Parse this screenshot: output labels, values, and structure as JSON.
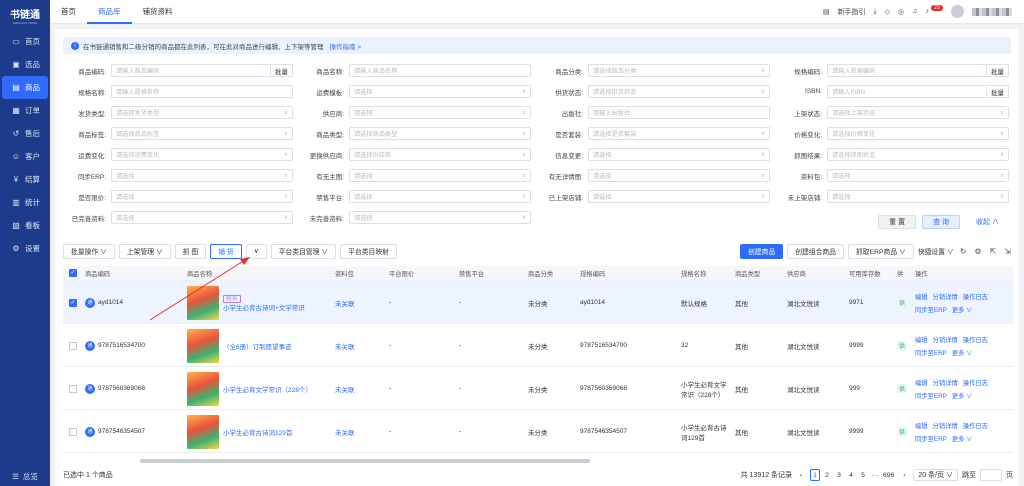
{
  "app": {
    "name": "书链通",
    "subtitle": "SHULIAN TONG"
  },
  "sidebar": {
    "items": [
      {
        "label": "首页",
        "icon": "desktop-icon"
      },
      {
        "label": "选品",
        "icon": "select-icon"
      },
      {
        "label": "商品",
        "icon": "product-icon"
      },
      {
        "label": "订单",
        "icon": "order-icon"
      },
      {
        "label": "售后",
        "icon": "aftersale-icon"
      },
      {
        "label": "客户",
        "icon": "customer-icon"
      },
      {
        "label": "结算",
        "icon": "settle-icon"
      },
      {
        "label": "统计",
        "icon": "stats-icon"
      },
      {
        "label": "看板",
        "icon": "board-icon"
      },
      {
        "label": "设置",
        "icon": "settings-icon"
      }
    ],
    "bottom": "总览"
  },
  "topbar": {
    "tabs": [
      "首页",
      "商品库",
      "铺货资料"
    ],
    "guide": "新手指引",
    "badge": "29"
  },
  "notice": {
    "text": "在书链通销售和二级分销的商品都在此列表，可在此对商品进行编辑、上下架等管理",
    "link": "操作指南 >"
  },
  "filters": [
    {
      "label": "商品编码:",
      "ph": "请输入商品编码",
      "batch": "批量"
    },
    {
      "label": "商品名称:",
      "ph": "请输入商品名称"
    },
    {
      "label": "商品分类:",
      "ph": "请选择商品分类",
      "chev": true
    },
    {
      "label": "规格编码:",
      "ph": "请输入规格编码",
      "batch": "批量"
    },
    {
      "label": "规格名称:",
      "ph": "请输入规格名称"
    },
    {
      "label": "运费模板:",
      "ph": "请选择",
      "chev": true
    },
    {
      "label": "供货状态:",
      "ph": "请选择供货状态",
      "chev": true
    },
    {
      "label": "ISBN:",
      "ph": "请输入ISBN",
      "batch": "批量"
    },
    {
      "label": "发货类型:",
      "ph": "请选择发货类型",
      "chev": true
    },
    {
      "label": "供应商:",
      "ph": "请选择",
      "chev": true
    },
    {
      "label": "出版社:",
      "ph": "请输入出版社"
    },
    {
      "label": "上架状态:",
      "ph": "请选择上架状态",
      "chev": true
    },
    {
      "label": "商品标签:",
      "ph": "请选择商品标签",
      "chev": true
    },
    {
      "label": "商品类型:",
      "ph": "请选择商品类型",
      "chev": true
    },
    {
      "label": "是否套装:",
      "ph": "请选择是否套装",
      "chev": true
    },
    {
      "label": "价格变化:",
      "ph": "请选择价格变化",
      "chev": true
    },
    {
      "label": "运费变化:",
      "ph": "请选择运费变化",
      "chev": true
    },
    {
      "label": "更换供应商:",
      "ph": "请选择供应商",
      "chev": true
    },
    {
      "label": "信息变更:",
      "ph": "请选择",
      "chev": true
    },
    {
      "label": "抓图结果:",
      "ph": "请选择抓图状态",
      "chev": true
    },
    {
      "label": "同步ERP:",
      "ph": "请选择",
      "chev": true
    },
    {
      "label": "有无主图:",
      "ph": "请选择",
      "chev": true
    },
    {
      "label": "有无详情图:",
      "ph": "请选择",
      "chev": true
    },
    {
      "label": "资料包:",
      "ph": "请选择",
      "chev": true
    },
    {
      "label": "是否限价:",
      "ph": "请选择",
      "chev": true
    },
    {
      "label": "禁售平台:",
      "ph": "请选择",
      "chev": true
    },
    {
      "label": "已上架店铺:",
      "ph": "请选择",
      "chev": true
    },
    {
      "label": "未上架店铺:",
      "ph": "请选择",
      "chev": true
    },
    {
      "label": "已完善资料:",
      "ph": "请选择",
      "chev": true
    },
    {
      "label": "未完善资料:",
      "ph": "请选择",
      "chev": true
    }
  ],
  "filter_buttons": {
    "reset": "重 置",
    "query": "查 询",
    "collapse": "收起 ∧"
  },
  "toolbar": {
    "batch": "批量操作 ∨",
    "shelf": "上架管理 ∨",
    "grab": "抓 图",
    "distribute": "铺 货",
    "category": "平台类目管理 ∨",
    "mapping": "平台类目映射",
    "create": "创建商品",
    "combo": "创建组合商品",
    "erp": "抓取ERP商品 ∨",
    "quick": "快捷设置 ∨"
  },
  "table": {
    "headers": [
      "商品编码",
      "商品名称",
      "资料包",
      "平台限价",
      "禁售平台",
      "商品分类",
      "规格编码",
      "规格名称",
      "商品类型",
      "供应商",
      "可用库存数",
      "供",
      "操作"
    ],
    "rows": [
      {
        "code": "ayd1014",
        "tag": "组合",
        "name": "小学生必背古诗词+文学常识",
        "pkg": "未关联",
        "limit": "-",
        "ban": "-",
        "cat": "未分类",
        "spec": "ayd1014",
        "specname": "默认规格",
        "type": "其他",
        "supplier": "湖北文悦读",
        "stock": "9971"
      },
      {
        "code": "9787516534700",
        "tag": "",
        "name": "（全6册）订制愿望事迹",
        "pkg": "未关联",
        "limit": "-",
        "ban": "-",
        "cat": "未分类",
        "spec": "9787516534700",
        "specname": "32",
        "type": "其他",
        "supplier": "湖北文悦读",
        "stock": "9999"
      },
      {
        "code": "9787560369068",
        "tag": "",
        "name": "小学生必背文学常识（228个）",
        "pkg": "未关联",
        "limit": "-",
        "ban": "-",
        "cat": "未分类",
        "spec": "9787560369068",
        "specname": "小学生必背文学常识（228个）",
        "type": "其他",
        "supplier": "湖北文悦读",
        "stock": "999"
      },
      {
        "code": "9787546354507",
        "tag": "",
        "name": "小学生必背古诗词129首",
        "pkg": "未关联",
        "limit": "-",
        "ban": "-",
        "cat": "未分类",
        "spec": "9787546354507",
        "specname": "小学生必背古诗词129首",
        "type": "其他",
        "supplier": "湖北文悦读",
        "stock": "9999"
      }
    ],
    "ops": [
      "编辑",
      "分销详情",
      "操作日志",
      "同步至ERP",
      "更多 ∨"
    ]
  },
  "footer": {
    "selected": "已选中 1 个商品",
    "total": "共 13912 条记录",
    "pages": [
      "1",
      "2",
      "3",
      "4",
      "5",
      "···",
      "696"
    ],
    "size": "20 条/页 ∨",
    "goto": "跳至",
    "page_unit": "页"
  },
  "colors": {
    "brand": "#1e3a8a",
    "accent": "#2f6bff"
  }
}
